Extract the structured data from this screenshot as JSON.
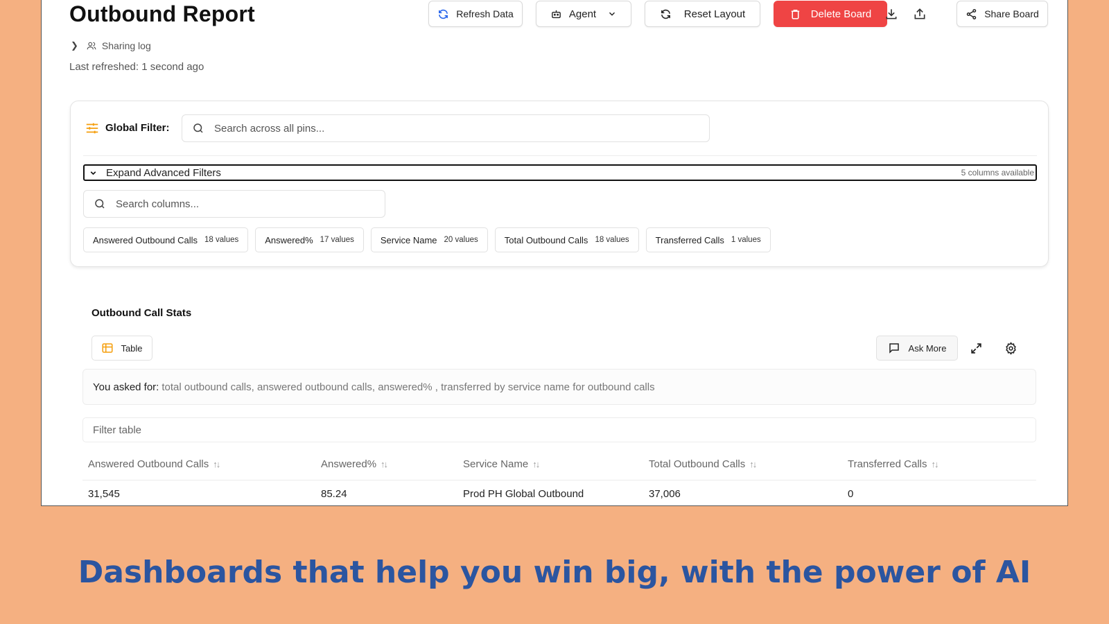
{
  "header": {
    "title": "Outbound Report",
    "breadcrumb_label": "Sharing log",
    "last_refreshed": "Last refreshed: 1 second ago",
    "buttons": {
      "refresh": "Refresh Data",
      "agent": "Agent",
      "reset": "Reset Layout",
      "delete": "Delete Board",
      "share": "Share Board"
    }
  },
  "filters": {
    "global_label": "Global Filter:",
    "global_placeholder": "Search across all pins...",
    "expand_label": "Expand Advanced Filters",
    "columns_available": "5 columns available",
    "column_search_placeholder": "Search columns...",
    "chips": [
      {
        "name": "Answered Outbound Calls",
        "count": "18 values"
      },
      {
        "name": "Answered%",
        "count": "17 values"
      },
      {
        "name": "Service Name",
        "count": "20 values"
      },
      {
        "name": "Total Outbound Calls",
        "count": "18 values"
      },
      {
        "name": "Transferred Calls",
        "count": "1 values"
      }
    ]
  },
  "stats": {
    "title": "Outbound Call Stats",
    "view_label": "Table",
    "ask_more": "Ask More",
    "asked_label": "You asked for:",
    "asked_text": "total outbound calls, answered outbound calls, answered% , transferred by service name for outbound calls",
    "filter_placeholder": "Filter table",
    "columns": [
      "Answered Outbound Calls",
      "Answered%",
      "Service Name",
      "Total Outbound Calls",
      "Transferred Calls"
    ],
    "rows": [
      [
        "31,545",
        "85.24",
        "Prod PH Global Outbound",
        "37,006",
        "0"
      ]
    ]
  },
  "tagline": "Dashboards that help you win big, with the power of AI",
  "colors": {
    "background": "#F5B081",
    "danger": "#EF4444",
    "tagline": "#2B55A0",
    "accent_orange": "#F59E0B",
    "accent_blue": "#2563EB"
  }
}
